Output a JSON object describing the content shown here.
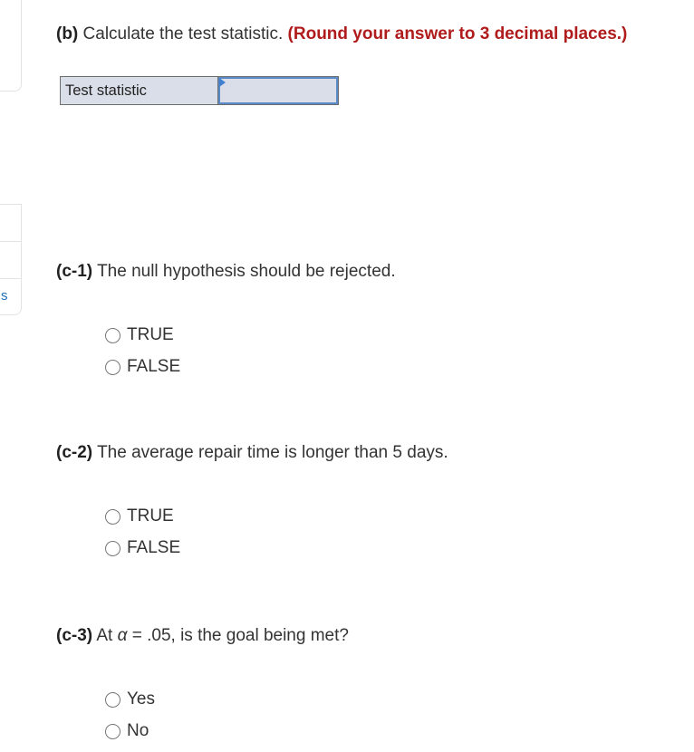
{
  "sidebar": {
    "link_fragment": "s"
  },
  "part_b": {
    "label": "(b)",
    "text": "Calculate the test statistic.",
    "hint": "(Round your answer to 3 decimal places.)",
    "table": {
      "row_label": "Test statistic",
      "input_value": ""
    }
  },
  "part_c1": {
    "label": "(c-1)",
    "text": "The null hypothesis should be rejected.",
    "options": [
      "TRUE",
      "FALSE"
    ]
  },
  "part_c2": {
    "label": "(c-2)",
    "text": "The average repair time is longer than 5 days.",
    "options": [
      "TRUE",
      "FALSE"
    ]
  },
  "part_c3": {
    "label": "(c-3)",
    "text_before": "At",
    "alpha_symbol": "α",
    "text_after": "= .05, is the goal being met?",
    "options": [
      "Yes",
      "No"
    ]
  },
  "colors": {
    "hint": "#b01c1c",
    "input_border": "#5b8ac6",
    "table_bg": "#d9dee8",
    "link": "#1f6fb5"
  }
}
